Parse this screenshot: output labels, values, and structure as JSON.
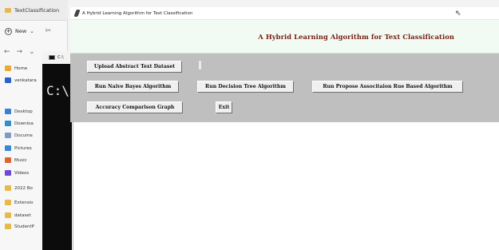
{
  "explorer": {
    "tab_title": "TextClassification",
    "new_label": "New",
    "new_chevron": "⌄",
    "nav": [
      "←",
      "→",
      "⌄"
    ],
    "sidebar": [
      {
        "label": "Home",
        "color": "#e6a93a",
        "icon": "home-icon"
      },
      {
        "label": "venkatara",
        "color": "#2a62c9",
        "icon": "cloud-icon"
      },
      {
        "label": "Desktop",
        "color": "#3c7fd8",
        "icon": "desktop-icon"
      },
      {
        "label": "Downloa",
        "color": "#2e8fcf",
        "icon": "download-icon"
      },
      {
        "label": "Docume",
        "color": "#7a9cc9",
        "icon": "documents-icon"
      },
      {
        "label": "Pictures",
        "color": "#3a86d6",
        "icon": "pictures-icon"
      },
      {
        "label": "Music",
        "color": "#e0622f",
        "icon": "music-icon"
      },
      {
        "label": "Videos",
        "color": "#6b4bd6",
        "icon": "videos-icon"
      },
      {
        "label": "2022 Bo",
        "color": "#e6b94a",
        "icon": "folder-icon"
      },
      {
        "label": "Extensio",
        "color": "#e6b94a",
        "icon": "folder-icon"
      },
      {
        "label": "dataset",
        "color": "#e6b94a",
        "icon": "folder-icon"
      },
      {
        "label": "StudentP",
        "color": "#e6b94a",
        "icon": "folder-icon"
      }
    ]
  },
  "console": {
    "tab_label": "C:\\",
    "text": "C:\\"
  },
  "app": {
    "window_title": "A Hybrid Learning Algorithm for Text Classification",
    "header_title": "A Hybrid Learning Algorithm for Text Classification",
    "buttons": {
      "upload": "Upload Abstract Text Dataset",
      "naive_bayes": "Run Naive Bayes Algorithm",
      "decision_tree": "Run Decision Tree Algorithm",
      "propose": "Run Propose Associtaion Rue Based Algorithm",
      "comparison": "Accuracy Comparison Graph",
      "exit": "Exit"
    }
  }
}
